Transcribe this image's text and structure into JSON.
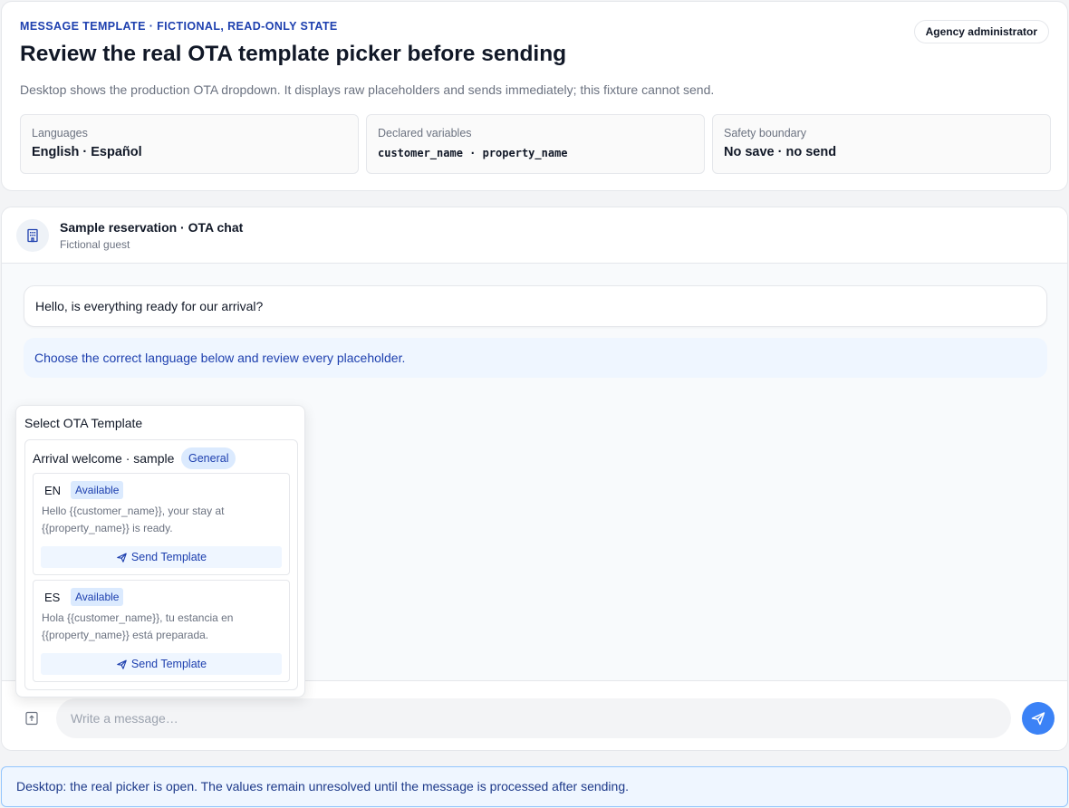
{
  "header": {
    "eyebrow": "MESSAGE TEMPLATE · FICTIONAL, READ-ONLY STATE",
    "role_badge": "Agency administrator",
    "title": "Review the real OTA template picker before sending",
    "subtitle": "Desktop shows the production OTA dropdown. It displays raw placeholders and sends immediately; this fixture cannot send.",
    "info": [
      {
        "label": "Languages",
        "value": "English · Español"
      },
      {
        "label": "Declared variables",
        "value": "customer_name · property_name"
      },
      {
        "label": "Safety boundary",
        "value": "No save · no send"
      }
    ]
  },
  "chat": {
    "icon": "building-icon",
    "title": "Sample reservation · OTA chat",
    "subtitle": "Fictional guest",
    "messages": [
      {
        "kind": "incoming",
        "text": "Hello, is everything ready for our arrival?"
      },
      {
        "kind": "hint",
        "text": "Choose the correct language below and review every placeholder."
      }
    ],
    "composer": {
      "placeholder": "Write a message…",
      "attach_icon": "template-icon",
      "send_icon": "send-icon"
    }
  },
  "picker": {
    "title": "Select OTA Template",
    "template": {
      "name": "Arrival welcome · sample",
      "tag": "General",
      "languages": [
        {
          "code": "EN",
          "status": "Available",
          "body": "Hello {{customer_name}}, your stay at {{property_name}} is ready.",
          "button": "Send Template"
        },
        {
          "code": "ES",
          "status": "Available",
          "body": "Hola {{customer_name}}, tu estancia en {{property_name}} está preparada.",
          "button": "Send Template"
        }
      ]
    }
  },
  "notice": "Desktop: the real picker is open. The values remain unresolved until the message is processed after sending.",
  "colors": {
    "accent": "#3b82f6",
    "accent_dark": "#1e40af",
    "tint": "#eff6ff",
    "border": "#e5e7eb"
  }
}
